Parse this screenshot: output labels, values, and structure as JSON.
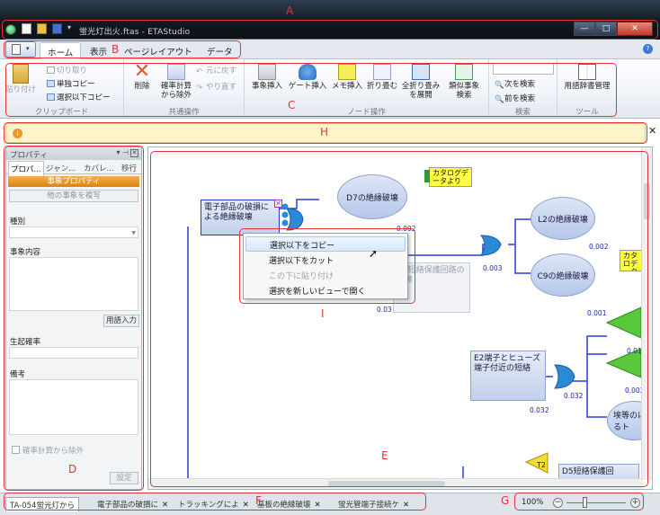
{
  "window": {
    "title": "蛍光灯出火.ftas - ETAStudio",
    "min": "—",
    "max": "□",
    "close": "✕"
  },
  "ribbon_tabs": [
    {
      "label": "ホーム"
    },
    {
      "label": "表示"
    },
    {
      "label": "ページレイアウト"
    },
    {
      "label": "データ"
    }
  ],
  "help": "?",
  "ribbon": {
    "clipboard": {
      "label": "クリップボード",
      "paste": "貼り付け",
      "cut": "切り取り",
      "copy_single": "単独コピー",
      "copy_below": "選択以下コピー"
    },
    "common": {
      "label": "共通操作",
      "delete": "削除",
      "exclude_line1": "確率計算",
      "exclude_line2": "から除外",
      "undo": "元に戻す",
      "redo": "やり直す"
    },
    "node": {
      "label": "ノード操作",
      "event_insert": "事象挿入",
      "gate_insert": "ゲート挿入",
      "memo_insert": "メモ挿入",
      "fold": "折り畳む",
      "expand_line1": "全折り畳み",
      "expand_line2": "を展開",
      "similar_line1": "類似事象",
      "similar_line2": "検索"
    },
    "search": {
      "label": "検索",
      "next": "次を検索",
      "prev": "前を検索"
    },
    "tools": {
      "label": "ツール",
      "dictionary": "用語辞書管理"
    }
  },
  "infobar": {
    "icon": "i",
    "close": "✕"
  },
  "properties": {
    "title": "プロパティ",
    "pin": "▾ ⊣",
    "close": "✕",
    "tabs": [
      "プロパ...",
      "ジャン...",
      "カバレ...",
      "移行"
    ],
    "header": "事象プロパティ",
    "copy_event": "他の事象を複写",
    "type_label": "種別",
    "content_label": "事象内容",
    "term_input": "用語入力",
    "probability_label": "生起確率",
    "notes_label": "備考",
    "exclude": "確率計算から除外",
    "settings": "設定"
  },
  "diagram": {
    "selected_node": "電子部品の破損による絶縁破壊",
    "nodes": [
      {
        "label": "D7の絶縁破壊",
        "prob": "0.002"
      },
      {
        "label": "L2の絶縁破壊",
        "prob": "0.002"
      },
      {
        "label": "C9の絶縁破壊",
        "prob": "0.001"
      },
      {
        "label": "E2端子とヒューズ端子付近の短絡",
        "prob": "0.032"
      },
      {
        "label": "D5短絡保護回路の故障",
        "prob": "0.03"
      },
      {
        "label": "埃等のによるト",
        "prob": ""
      },
      {
        "label": "D5短絡保護回",
        "prob": ""
      }
    ],
    "gate_probs": [
      "0.003",
      "0.032",
      "0.01",
      "0.002"
    ],
    "catalog1": "カタログデータより",
    "catalog2": "カタロデータ",
    "t2": "T2"
  },
  "context_menu": [
    {
      "label": "選択以下をコピー"
    },
    {
      "label": "選択以下をカット"
    },
    {
      "label": "この下に貼り付け"
    },
    {
      "label": "選択を新しいビューで開く"
    }
  ],
  "bottom_tabs": [
    {
      "label": "TA-054蛍光灯から"
    },
    {
      "label": "電子部品の破損に"
    },
    {
      "label": "トラッキングによ"
    },
    {
      "label": "基板の絶縁破壊"
    },
    {
      "label": "蛍光管端子接続ケ"
    }
  ],
  "tab_close": "✕",
  "zoom": {
    "value": "100%",
    "minus": "−",
    "plus": "+"
  },
  "annotations": [
    "A",
    "B",
    "C",
    "H",
    "D",
    "E",
    "F",
    "G",
    "I"
  ],
  "colors": {
    "accent_orange": "#d98512",
    "annotation_red": "#e8303a",
    "node_blue": "#b6c7ea",
    "memo_yellow": "#ffff40"
  }
}
